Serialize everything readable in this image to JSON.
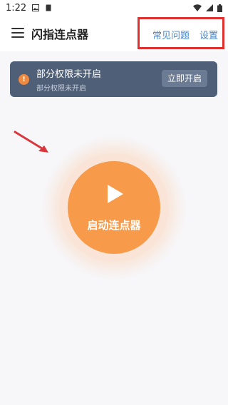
{
  "status_bar": {
    "time": "1:22",
    "icons": [
      "image-icon",
      "sd-card-icon",
      "wifi-icon",
      "signal-icon",
      "battery-icon"
    ]
  },
  "app_bar": {
    "title": "闪指连点器",
    "menu_icon": "hamburger-menu-icon",
    "faq_label": "常见问题",
    "settings_label": "设置"
  },
  "notice": {
    "icon": "warning-icon",
    "icon_glyph": "!",
    "title": "部分权限未开启",
    "subtitle": "部分权限未开启",
    "button_label": "立即开启"
  },
  "start": {
    "icon": "play-icon",
    "label": "启动连点器"
  },
  "colors": {
    "accent_orange": "#f79a4a",
    "notice_bg": "#4f5f78",
    "link_blue": "#4a86c9",
    "highlight_red": "#e0302f"
  }
}
